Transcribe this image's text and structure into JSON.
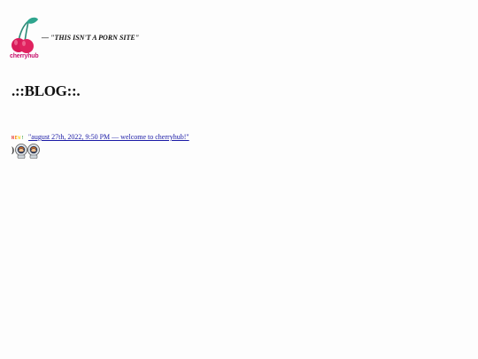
{
  "header": {
    "logo_text": "cherryhub",
    "tagline": "— \"THIS ISN'T A PORN SITE\""
  },
  "main": {
    "heading": ".::BLOG::.",
    "new_badge": "NEW!",
    "posts": [
      {
        "link_text": "\"august 27th, 2022, 9:50 PM — welcome to cherryhub!\""
      }
    ],
    "decorations": {
      "bullet": ")",
      "icons": [
        "astronaut-icon",
        "astronaut-icon"
      ]
    }
  },
  "colors": {
    "cherry": "#e0225f",
    "stem": "#2fa58e",
    "brand_text": "#c8146e",
    "link": "#1a1aa6",
    "new_badge": [
      "#e53935",
      "#fb8c00",
      "#fdd835",
      "#43a047"
    ]
  }
}
